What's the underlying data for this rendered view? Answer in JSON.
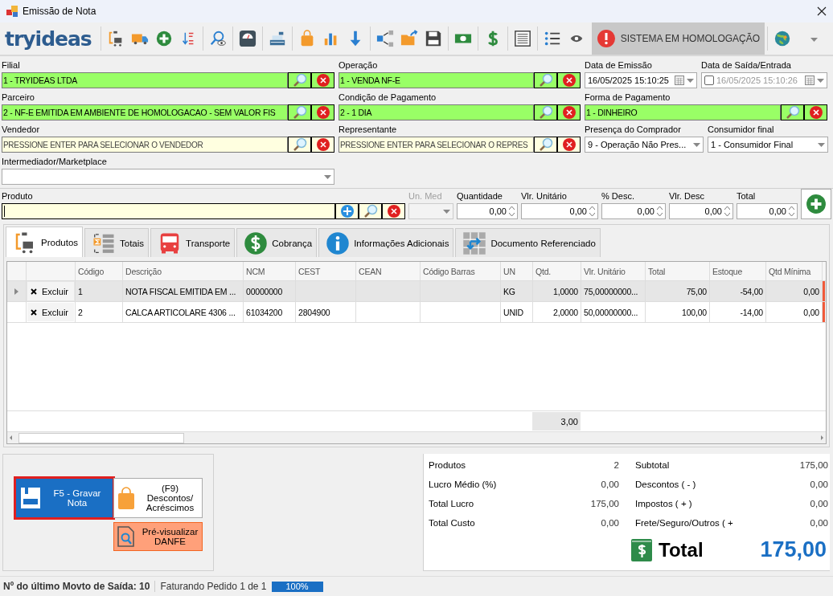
{
  "window": {
    "title": "Emissão de Nota"
  },
  "toolbar": {
    "logo": "tryideas",
    "banner": "SISTEMA EM HOMOLOGAÇÃO"
  },
  "form_rows": [
    [
      {
        "kind": "lookup",
        "label": "Filial",
        "value": "1 - TRYIDEAS LTDA"
      },
      {
        "kind": "lookup",
        "label": "Operação",
        "value": "1 - VENDA NF-E"
      },
      {
        "kind": "date",
        "label": "Data de Emissão",
        "value": "16/05/2025 15:10:25"
      },
      {
        "kind": "date",
        "label": "Data de Saída/Entrada",
        "value": "16/05/2025 15:10:26",
        "checked": false
      }
    ],
    [
      {
        "kind": "lookup",
        "label": "Parceiro",
        "value": "2 - NF-E EMITIDA EM AMBIENTE DE HOMOLOGACAO - SEM VALOR FIS"
      },
      {
        "kind": "lookup",
        "label": "Condição de Pagamento",
        "value": "2 - 1 DIA"
      },
      {
        "kind": "lookup",
        "label": "Forma de Pagamento",
        "value": "1 - DINHEIRO"
      }
    ],
    [
      {
        "kind": "lookup",
        "label": "Vendedor",
        "placeholder": "PRESSIONE ENTER PARA SELECIONAR O VENDEDOR"
      },
      {
        "kind": "lookup",
        "label": "Representante",
        "placeholder": "PRESSIONE ENTER PARA SELECIONAR O REPRES"
      },
      {
        "kind": "select",
        "label": "Presença do Comprador",
        "value": "9 - Operação Não Pres..."
      },
      {
        "kind": "select",
        "label": "Consumidor final",
        "value": "1 - Consumidor Final"
      }
    ],
    [
      {
        "kind": "select",
        "label": "Intermediador/Marketplace"
      }
    ]
  ],
  "product_entry": {
    "label": "Produto",
    "fields": [
      {
        "kind": "select",
        "label": "Un. Med",
        "disabled": true
      },
      {
        "kind": "spin",
        "label": "Quantidade",
        "value": "0,00",
        "disabled": false
      },
      {
        "kind": "spin",
        "label": "Vlr. Unitário",
        "value": "0,00",
        "disabled": false
      },
      {
        "kind": "spin",
        "label": "% Desc.",
        "value": "0,00",
        "disabled": false
      },
      {
        "kind": "spin",
        "label": "Vlr. Desc",
        "value": "0,00",
        "disabled": false
      },
      {
        "kind": "spin",
        "label": "Total",
        "value": "0,00",
        "disabled": false
      }
    ]
  },
  "tabs": [
    {
      "kind": "products",
      "label": "Produtos",
      "selected": true
    },
    {
      "kind": "totals",
      "label": "Totais",
      "selected": false
    },
    {
      "kind": "transport",
      "label": "Transporte",
      "selected": false
    },
    {
      "kind": "billing",
      "label": "Cobrança",
      "selected": false
    },
    {
      "kind": "info",
      "label": "Informações Adicionais",
      "selected": false
    },
    {
      "kind": "reference",
      "label": "Documento Referenciado",
      "selected": false
    }
  ],
  "table": {
    "columns": [
      {
        "label": "Código"
      },
      {
        "label": "Descrição"
      },
      {
        "label": "NCM"
      },
      {
        "label": "CEST"
      },
      {
        "label": "CEAN"
      },
      {
        "label": "Código Barras"
      },
      {
        "label": "UN"
      },
      {
        "label": "Qtd.",
        "total": "3,00"
      },
      {
        "label": "Vlr. Unitário"
      },
      {
        "label": "Total"
      },
      {
        "label": "Estoque"
      },
      {
        "label": "Qtd Mínima"
      }
    ],
    "rows": [
      {
        "selected": true,
        "action": "Excluir",
        "cells": [
          "1",
          "NOTA FISCAL EMITIDA EM ...",
          "00000000",
          null,
          null,
          null,
          "KG",
          "1,0000",
          "75,00000000...",
          "75,00",
          "-54,00",
          "0,00"
        ]
      },
      {
        "selected": false,
        "action": "Excluir",
        "cells": [
          "2",
          "CALCA ARTICOLARE 4306 ...",
          "61034200",
          "2804900",
          null,
          null,
          "UNID",
          "2,0000",
          "50,00000000...",
          "100,00",
          "-14,00",
          "0,00"
        ]
      }
    ]
  },
  "buttons": [
    {
      "kind": "save",
      "label": "F5 - Gravar Nota",
      "focused": true
    },
    {
      "kind": "discount",
      "label": "(F9)\nDescontos/\nAcréscimos",
      "focused": false
    },
    {
      "kind": "preview",
      "label": "Pré-visualizar\nDANFE",
      "focused": false
    }
  ],
  "summary": {
    "left": [
      {
        "label": "Produtos",
        "value": "2"
      },
      {
        "label": "Lucro Médio (%)",
        "value": "0,00"
      },
      {
        "label": "Total Lucro",
        "value": "175,00"
      },
      {
        "label": "Total Custo",
        "value": "0,00"
      }
    ],
    "right": [
      {
        "label": "Subtotal",
        "value": "175,00"
      },
      {
        "label": "Descontos ( - )",
        "value": "0,00"
      },
      {
        "label": "Impostos ( + )",
        "value": "0,00"
      },
      {
        "label": "Frete/Seguro/Outros ( +",
        "value": "0,00"
      }
    ],
    "total": {
      "label": "Total",
      "value": "175,00"
    }
  },
  "status_bar": {
    "last_movement": "Nº do último Movto de Saída: 10",
    "progress_text": "Faturando Pedido 1 de 1",
    "progress": {
      "level": 1,
      "label": "100%"
    }
  }
}
